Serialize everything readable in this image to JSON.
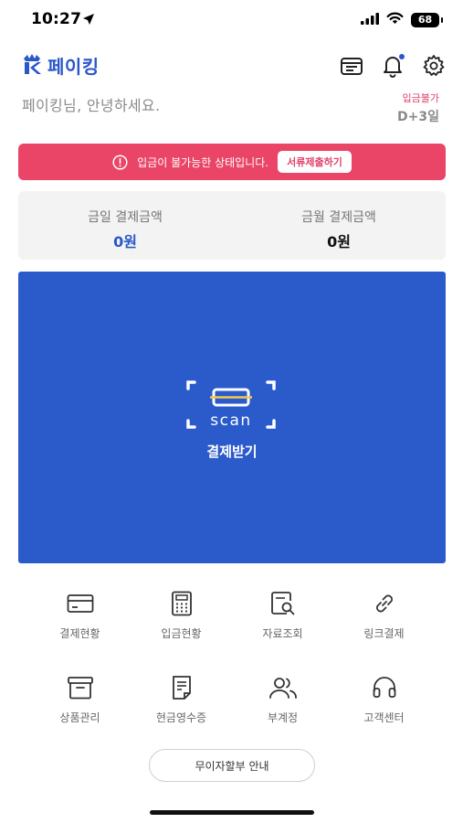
{
  "status_bar": {
    "time": "10:27",
    "battery": "68",
    "icons": [
      "location-arrow-icon",
      "signal-icon",
      "wifi-icon",
      "battery-icon"
    ]
  },
  "header": {
    "logo_text": "페이킹",
    "icons": [
      "calendar-icon",
      "bell-icon",
      "gear-icon"
    ]
  },
  "greeting": "페이킹님, 안녕하세요.",
  "deposit": {
    "status": "입금불가",
    "days": "D+3일"
  },
  "alert": {
    "text": "입금이 불가능한 상태입니다.",
    "button_label": "서류제출하기",
    "color": "#ea4467"
  },
  "summary": {
    "today_label": "금일 결제금액",
    "today_value": "0원",
    "month_label": "금월 결제금액",
    "month_value": "0원"
  },
  "scan_panel": {
    "icon_text": "scan",
    "label": "결제받기",
    "color": "#2b5acb"
  },
  "menu": [
    {
      "label": "결제현황",
      "icon": "card-icon"
    },
    {
      "label": "입금현황",
      "icon": "calculator-icon"
    },
    {
      "label": "자료조회",
      "icon": "document-search-icon"
    },
    {
      "label": "링크결제",
      "icon": "link-icon"
    },
    {
      "label": "상품관리",
      "icon": "box-icon"
    },
    {
      "label": "현금영수증",
      "icon": "receipt-icon"
    },
    {
      "label": "부계정",
      "icon": "users-icon"
    },
    {
      "label": "고객센터",
      "icon": "headset-icon"
    }
  ],
  "installment_button": "무이자할부 안내"
}
